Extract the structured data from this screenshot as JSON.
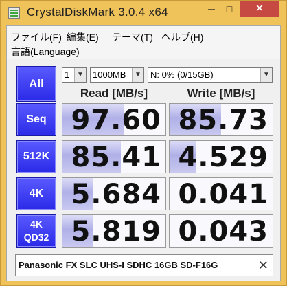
{
  "window": {
    "title": "CrystalDiskMark 3.0.4 x64",
    "minimize_glyph": "─",
    "maximize_glyph": "□",
    "close_glyph": "✕",
    "accent": "#f0c35a",
    "close_color": "#c74a42"
  },
  "menu": {
    "items": [
      "ファイル(F)",
      "編集(E)",
      "テーマ(T)",
      "ヘルプ(H)",
      "言語(Language)"
    ]
  },
  "toolbar": {
    "all_label": "All",
    "count_value": "1",
    "size_value": "1000MB",
    "drive_value": "N: 0% (0/15GB)"
  },
  "headers": {
    "read": "Read [MB/s]",
    "write": "Write [MB/s]"
  },
  "rows": [
    {
      "label": "Seq",
      "read": "97.60",
      "write": "85.73",
      "read_fill": 0.6,
      "write_fill": 0.5
    },
    {
      "label": "512K",
      "read": "85.41",
      "write": "4.529",
      "read_fill": 0.57,
      "write_fill": 0.26
    },
    {
      "label": "4K",
      "read": "5.684",
      "write": "0.041",
      "read_fill": 0.3,
      "write_fill": 0.0
    },
    {
      "label": "4K\nQD32",
      "read": "5.819",
      "write": "0.043",
      "read_fill": 0.3,
      "write_fill": 0.0
    }
  ],
  "comment": {
    "text": "Panasonic FX SLC UHS-I SDHC 16GB SD-F16G",
    "clear_glyph": "✕"
  },
  "colors": {
    "button_blue": "#3030f0",
    "bar_fill": "#b0b0e8"
  }
}
